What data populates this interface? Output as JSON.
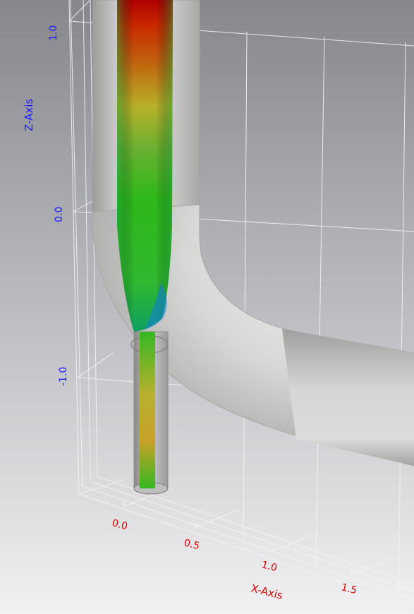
{
  "scene": {
    "z_axis": {
      "title": "Z-Axis",
      "color": "#1a1aff",
      "ticks": [
        "1.0",
        "0.0",
        "-1.0"
      ]
    },
    "x_axis": {
      "title": "X-Axis",
      "color": "#e00000",
      "ticks": [
        "0.0",
        "0.5",
        "1.0",
        "1.5"
      ]
    },
    "background": {
      "top": "#86878d",
      "bottom": "#f1f1f3"
    },
    "pipe_color": "#d8d8d6",
    "colormap": [
      "#0060ff",
      "#00c0b0",
      "#2eb81a",
      "#c8c000",
      "#d84a00",
      "#b00000"
    ]
  }
}
